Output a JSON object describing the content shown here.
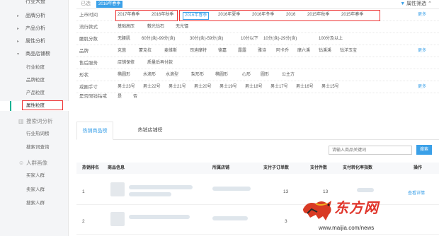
{
  "sidebar": {
    "top_truncated": "行业大盘",
    "items": [
      {
        "label": "品牌分析"
      },
      {
        "label": "产品分析"
      },
      {
        "label": "属性分析"
      },
      {
        "label": "商品店铺榜"
      }
    ],
    "sub_items": [
      {
        "label": "行业粒度"
      },
      {
        "label": "品牌粒度"
      },
      {
        "label": "产品粒度"
      },
      {
        "label": "属性粒度"
      }
    ],
    "groups": [
      {
        "label": "搜索词分析",
        "sub": [
          "行业热词榜",
          "搜索词查询"
        ]
      },
      {
        "label": "人群画像",
        "sub": [
          "买家人群",
          "卖家人群",
          "搜索人群"
        ]
      }
    ]
  },
  "topbar": {
    "selected_label": "已选",
    "selected_tag": "2016年春季",
    "attr_filter": "属性筛选"
  },
  "filters": [
    {
      "label": "上市时间",
      "options": [
        "2017年春季",
        "2016年秋季",
        "2016年春季",
        "2016年夏季",
        "2016年冬季",
        "2016",
        "2015年秋季",
        "2015年春季"
      ],
      "more": "更多"
    },
    {
      "label": "流行款式",
      "options": [
        "韩版",
        "甜美"
      ],
      "extra": [
        "基础高压",
        "敷光钻石",
        "无光镭"
      ],
      "more": ""
    },
    {
      "label": "腰肌分数",
      "options": [
        "无腰肌",
        "60分(含)-99分(含)",
        "30分(含)-59分(含)",
        "10分以下",
        "10分(含)-29分(含)",
        "100分及以上"
      ],
      "more": ""
    },
    {
      "label": "品牌",
      "options": [
        "克茵",
        "蒙克拉",
        "麦维斯",
        "司迪摩特",
        "德嘉",
        "露露",
        "雅诗",
        "阿卡乔",
        "摩六溪",
        "钻溪溪",
        "钻洋玉宝"
      ],
      "more": "更多"
    },
    {
      "label": "售后服务",
      "options": [
        "店铺保修",
        "质量后再付款"
      ],
      "more": ""
    },
    {
      "label": "形状",
      "options": [
        "椭圆形",
        "水滴形",
        "水滴型",
        "梨形形",
        "椭圆形",
        "心形",
        "圆形",
        "公主方"
      ],
      "more": ""
    },
    {
      "label": "戒圈手寸",
      "options": [
        "男士23号",
        "男士22号",
        "男士21号",
        "男士20号",
        "男士19号",
        "男士18号",
        "男士17号",
        "男士16号",
        "男士15号"
      ],
      "more": "更多"
    },
    {
      "label": "是否限钱钻戒",
      "options": [
        "是",
        "否"
      ],
      "more": ""
    }
  ],
  "tabs": [
    {
      "label": "热销商品榜"
    },
    {
      "label": "热销店铺榜"
    }
  ],
  "search": {
    "placeholder": "请输入商品关键词",
    "button": "搜索"
  },
  "table": {
    "headers": [
      "热销排名",
      "商品信息",
      "所属店铺",
      "支付子订单数",
      "支付件数",
      "支付转化率指数",
      "操作"
    ],
    "rows": [
      {
        "rank": "1",
        "orders": "13",
        "pieces": "13",
        "action": "查看详情"
      },
      {
        "rank": "2",
        "orders": "3",
        "pieces": "",
        "action": ""
      }
    ]
  },
  "watermark": {
    "title": "东方网",
    "url": "www.maijia.com/news"
  },
  "colors": {
    "accent": "#3aa0e8",
    "highlight_box": "#ee3333",
    "active_marker": "#1ab394"
  }
}
